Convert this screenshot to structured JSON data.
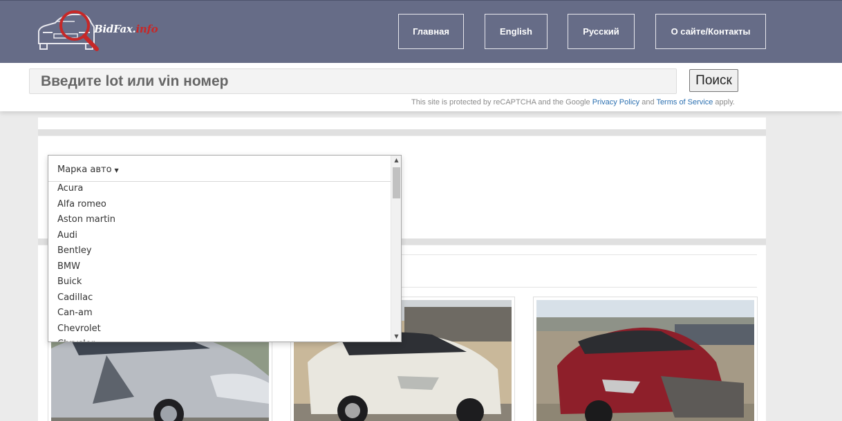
{
  "header": {
    "logo_text_main": "BidFax.",
    "logo_text_accent": "info",
    "nav": [
      "Главная",
      "English",
      "Русский",
      "О сайте/Контакты"
    ]
  },
  "search": {
    "placeholder": "Введите lot или vin номер",
    "button_label": "Поиск",
    "captcha_prefix": "This site is protected by reCAPTCHA and the Google",
    "captcha_privacy": "Privacy Policy",
    "captcha_and": "and",
    "captcha_terms": "Terms of Service",
    "captcha_suffix": "apply."
  },
  "filter": {
    "make_label": "Марка авто",
    "makes": [
      "Acura",
      "Alfa romeo",
      "Aston martin",
      "Audi",
      "Bentley",
      "BMW",
      "Buick",
      "Cadillac",
      "Can-am",
      "Chevrolet",
      "Chrysler"
    ]
  },
  "colors": {
    "header_bg": "#666c87",
    "link": "#2a6fb0",
    "logo_accent": "#c62828"
  },
  "cards": [
    {
      "car_color": "silver"
    },
    {
      "car_color": "white"
    },
    {
      "car_color": "red"
    }
  ]
}
